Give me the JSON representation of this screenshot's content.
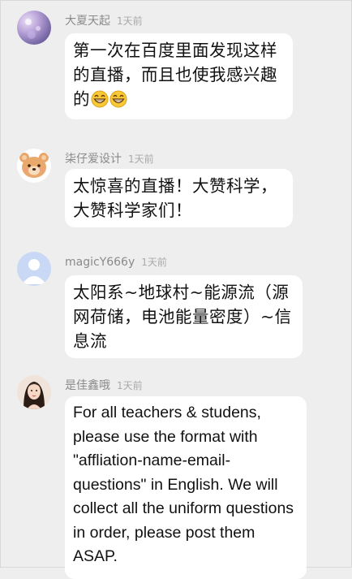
{
  "comments": [
    {
      "name": "大夏天起",
      "time": "1天前",
      "text": "第一次在百度里面发现这样的直播，而且也使我感兴趣的",
      "emojis": [
        "grinning-face-icon",
        "grinning-face-icon"
      ]
    },
    {
      "name": "柒仔爱设计",
      "time": "1天前",
      "text": "太惊喜的直播！大赞科学，大赞科学家们！"
    },
    {
      "name": "magicY666y",
      "time": "1天前",
      "text": "太阳系~地球村~能源流（源网荷储，电池能量密度）~信息流"
    },
    {
      "name": "是佳鑫哦",
      "time": "1天前",
      "text": "For all teachers & studens, please use the format with \"affliation-name-email-questions\" in English. We will collect all the uniform questions in order, please post them ASAP."
    }
  ]
}
